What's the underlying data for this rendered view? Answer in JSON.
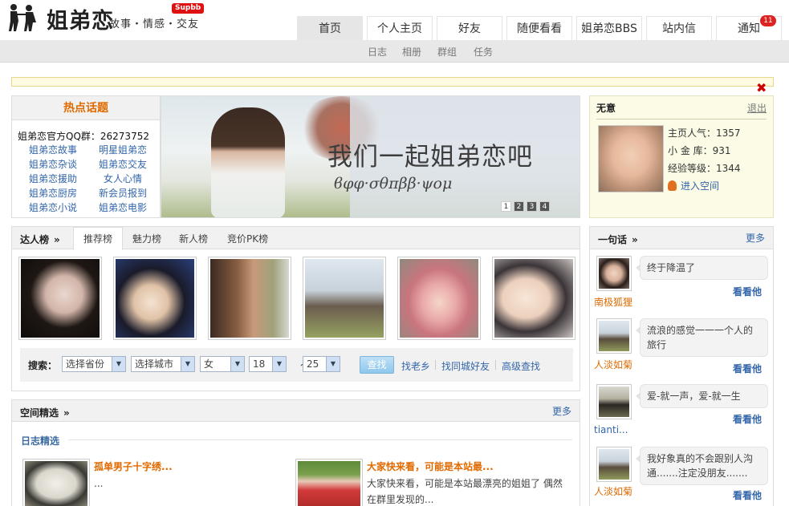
{
  "header": {
    "brand": "姐弟恋",
    "slogan": "故事・情感・交友",
    "supbb": "Supbb",
    "nav": [
      {
        "label": "首页",
        "active": true
      },
      {
        "label": "个人主页"
      },
      {
        "label": "好友"
      },
      {
        "label": "随便看看"
      },
      {
        "label": "姐弟恋BBS"
      },
      {
        "label": "站内信"
      },
      {
        "label": "通知",
        "badge": "11"
      }
    ],
    "subnav": [
      "日志",
      "相册",
      "群组",
      "任务"
    ]
  },
  "hot_topics": {
    "title": "热点话题",
    "qq_group": "姐弟恋官方QQ群：26273752",
    "links": [
      "姐弟恋故事",
      "明星姐弟恋",
      "姐弟恋杂谈",
      "姐弟恋交友",
      "姐弟恋援助",
      "女人心情",
      "姐弟恋厨房",
      "新会员报到",
      "姐弟恋小说",
      "姐弟恋电影"
    ]
  },
  "banner": {
    "headline": "我们一起姐弟恋吧",
    "subline": "ϐφφ·σθπββ·ψομ",
    "pages": [
      "1",
      "2",
      "3",
      "4"
    ],
    "active_page": 1
  },
  "user": {
    "name": "无意",
    "logout": "退出",
    "stats": [
      "主页人气：1357",
      "小 金 库：931",
      "经验等级：1344"
    ],
    "enter_space": "进入空间"
  },
  "talent": {
    "title": "达人榜",
    "chevron": "»",
    "tabs": [
      "推荐榜",
      "魅力榜",
      "新人榜",
      "竞价PK榜"
    ],
    "active_tab": 0,
    "search": {
      "label": "搜索：",
      "province": "选择省份",
      "city": "选择城市",
      "gender": "女",
      "age_from": "18",
      "tilde": "～",
      "age_to": "25",
      "button": "查找",
      "links": [
        "找老乡",
        "找同城好友",
        "高级查找"
      ]
    }
  },
  "space": {
    "title": "空间精选",
    "chevron": "»",
    "more": "更多",
    "subtitle": "日志精选",
    "blogs": [
      {
        "title": "孤单男子十字绣...",
        "desc": "..."
      },
      {
        "title": "大家快来看，可能是本站最...",
        "desc": "大家快来看，可能是本站最漂亮的姐姐了 偶然在群里发现的..."
      }
    ]
  },
  "oneline": {
    "title": "一句话",
    "chevron": "»",
    "more": "更多",
    "items": [
      {
        "name": "南极狐狸",
        "text": "终于降温了",
        "see": "看看他"
      },
      {
        "name": "人淡如菊",
        "text": "流浪的感觉一一一个人的旅行",
        "see": "看看他"
      },
      {
        "name": "tianti...",
        "text": "爱-就一声，爱-就一生",
        "see": "看看他"
      },
      {
        "name": "人淡如菊",
        "text": "我好象真的不会跟别人沟通.......注定没朋友.......",
        "see": "看看他"
      }
    ]
  },
  "colors": {
    "accent": "#e06a00",
    "link": "#3366aa",
    "badge": "#dd2222"
  }
}
